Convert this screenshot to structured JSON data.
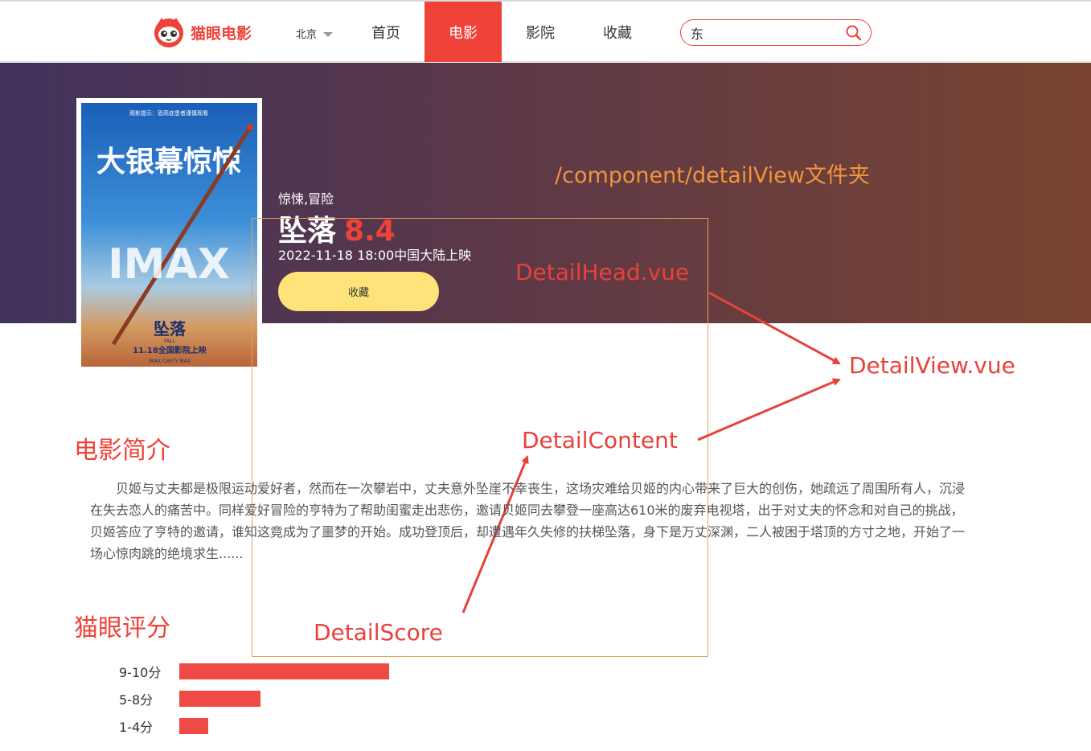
{
  "header": {
    "logo_text": "猫眼电影",
    "city": "北京",
    "nav": [
      {
        "label": "首页",
        "active": false
      },
      {
        "label": "电影",
        "active": true
      },
      {
        "label": "影院",
        "active": false
      },
      {
        "label": "收藏",
        "active": false
      }
    ],
    "search_value": "东"
  },
  "movie": {
    "genre": "惊悚,冒险",
    "title": "坠落",
    "score": "8.4",
    "release": "2022-11-18 18:00中国大陆上映",
    "collect_label": "收藏",
    "poster": {
      "top_notice": "观影提示：恐高症患者谨慎观看",
      "headline": "大银幕惊悚",
      "imax": "IMAX",
      "poster_title": "坠落",
      "poster_title_en": "FALL",
      "poster_date": "11.18全国影院上映",
      "poster_brands": "IMAX  CINITY  MAX"
    }
  },
  "annotations": {
    "folder": "/component/detailView文件夹",
    "head": "DetailHead.vue",
    "view": "DetailView.vue",
    "content": "DetailContent",
    "score": "DetailScore"
  },
  "intro": {
    "title": "电影简介",
    "text": "贝姬与丈夫都是极限运动爱好者，然而在一次攀岩中，丈夫意外坠崖不幸丧生，这场灾难给贝姬的内心带来了巨大的创伤，她疏远了周围所有人，沉浸在失去恋人的痛苦中。同样爱好冒险的亨特为了帮助闺蜜走出悲伤，邀请贝姬同去攀登一座高达610米的废弃电视塔，出于对丈夫的怀念和对自己的挑战，贝姬答应了亨特的邀请，谁知这竟成为了噩梦的开始。成功登顶后，却遭遇年久失修的扶梯坠落，身下是万丈深渊，二人被困于塔顶的方寸之地，开始了一场心惊肉跳的绝境求生......"
  },
  "rating": {
    "title": "猫眼评分",
    "distribution": [
      {
        "label": "9-10分",
        "share": 0.72
      },
      {
        "label": "5-8分",
        "share": 0.28
      },
      {
        "label": "1-4分",
        "share": 0.1
      }
    ]
  },
  "colors": {
    "brand": "#ef4238",
    "button": "#fde37a",
    "annotation_red": "#e8413b",
    "annotation_orange": "#f0943c"
  }
}
